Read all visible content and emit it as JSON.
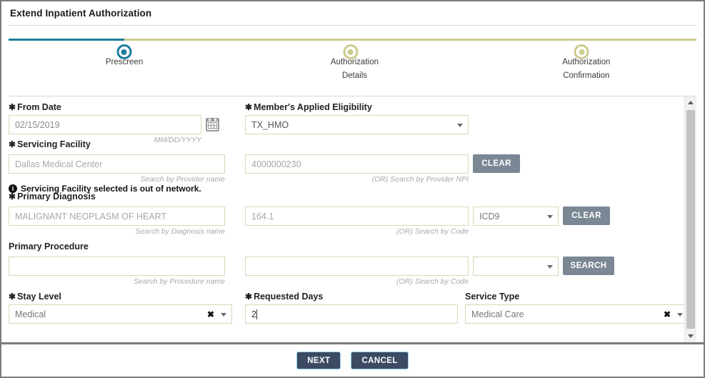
{
  "window": {
    "title": "Extend Inpatient Authorization"
  },
  "stepper": {
    "active_color": "#1a7d9b",
    "inactive_color": "#cdcb8e",
    "steps": [
      {
        "label_line1": "Prescreen",
        "label_line2": "",
        "state": "active"
      },
      {
        "label_line1": "Authorization",
        "label_line2": "Details",
        "state": "inactive"
      },
      {
        "label_line1": "Authorization",
        "label_line2": "Confirmation",
        "state": "inactive"
      }
    ]
  },
  "form": {
    "required_marker": "✱",
    "from_date": {
      "label": "From Date",
      "value": "02/15/2019",
      "placeholder": "02/15/2019",
      "hint": "MM/DD/YYYY",
      "calendar_icon": "calendar-icon"
    },
    "member_eligibility": {
      "label": "Member's Applied Eligibility",
      "value": "TX_HMO"
    },
    "servicing_facility": {
      "label": "Servicing Facility",
      "name_value": "Dallas Medical Center",
      "name_hint": "Search by Provider name",
      "npi_value": "4000000230",
      "npi_hint": "(OR) Search by Provider NPI",
      "clear_label": "CLEAR",
      "warning": "Servicing Facility selected is out of network."
    },
    "primary_diagnosis": {
      "label": "Primary Diagnosis",
      "name_value": "MALIGNANT NEOPLASM OF HEART",
      "name_hint": "Search by Diagnosis name",
      "code_value": "164.1",
      "code_hint": "(OR) Search by Code",
      "code_type_value": "ICD9",
      "clear_label": "CLEAR"
    },
    "primary_procedure": {
      "label": "Primary Procedure",
      "name_value": "",
      "name_hint": "Search by Procedure name",
      "code_value": "",
      "code_hint": "(OR) Search by Code",
      "code_type_value": "",
      "search_label": "SEARCH"
    },
    "stay_level": {
      "label": "Stay Level",
      "value": "Medical"
    },
    "requested_days": {
      "label": "Requested Days",
      "value": "2"
    },
    "service_type": {
      "label": "Service Type",
      "value": "Medical Care"
    }
  },
  "footer": {
    "next_label": "NEXT",
    "cancel_label": "CANCEL"
  }
}
